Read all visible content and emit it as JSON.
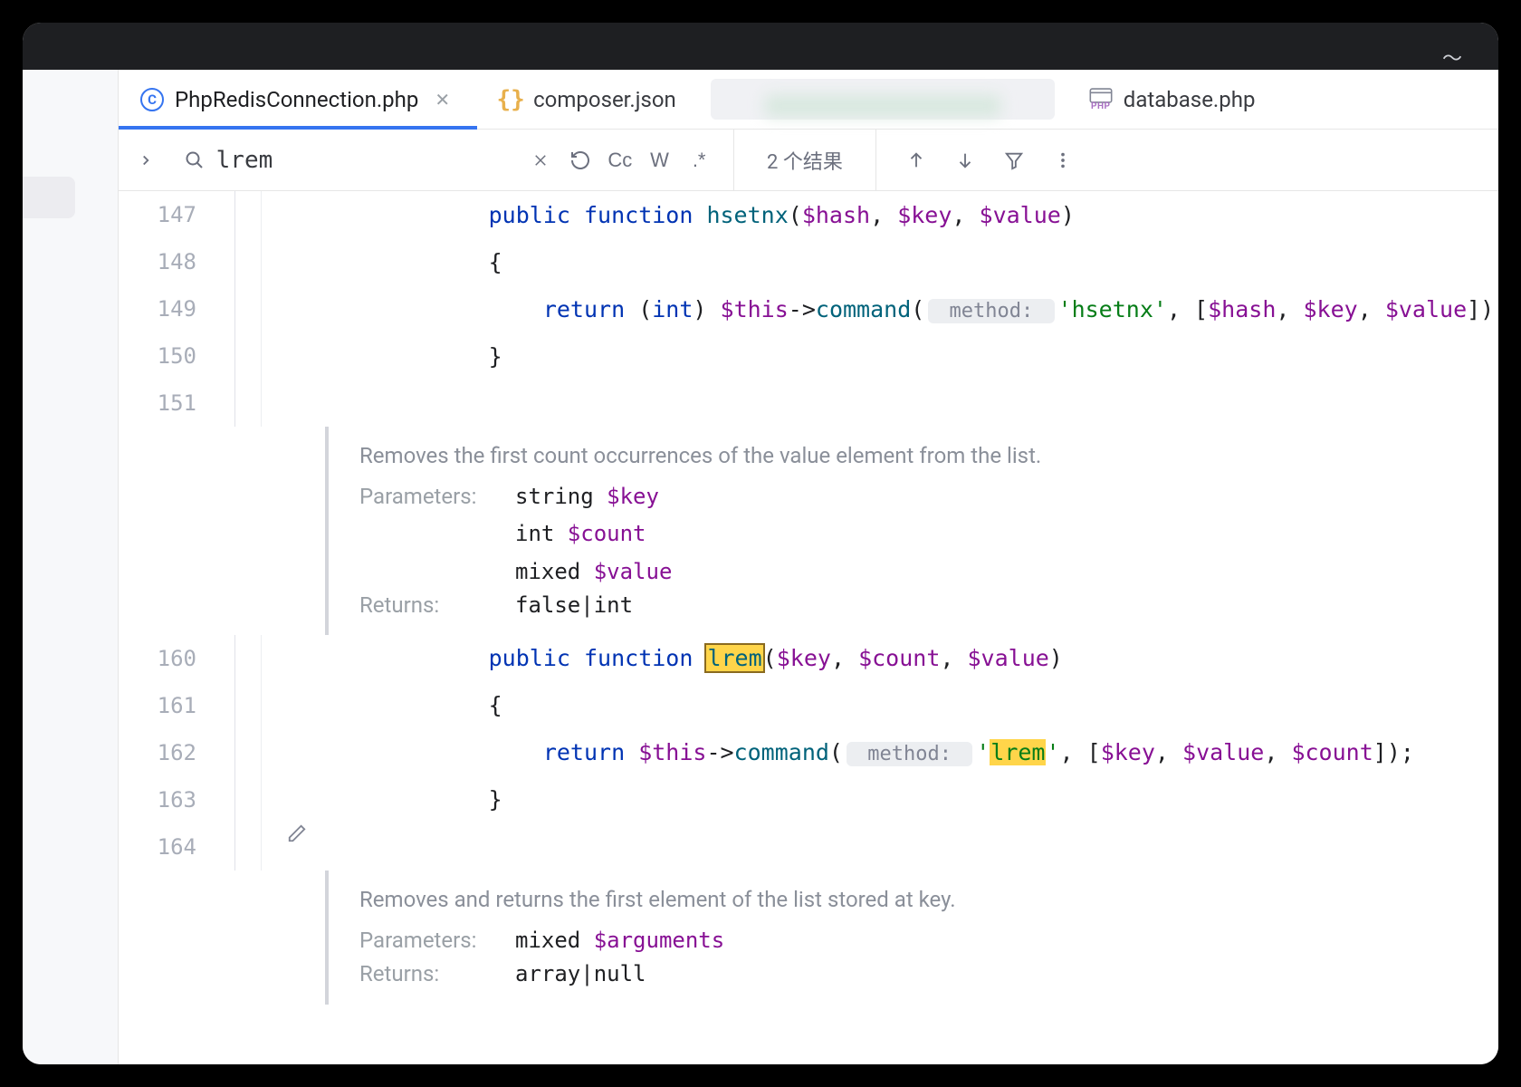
{
  "tabs": [
    {
      "label": "PhpRedisConnection.php",
      "icon": "c-circle",
      "active": true,
      "closeable": true
    },
    {
      "label": "composer.json",
      "icon": "braces",
      "active": false,
      "closeable": false
    },
    {
      "label": "",
      "icon": "blurred",
      "active": false
    },
    {
      "label": "database.php",
      "icon": "php",
      "active": false,
      "closeable": false
    }
  ],
  "search": {
    "query": "lrem",
    "results_text": "2 个结果",
    "options": {
      "cc": "Cc",
      "w": "W",
      "regex": ".*"
    }
  },
  "code": {
    "lines": [
      {
        "n": 147,
        "indent": 3,
        "tokens": [
          {
            "t": "public ",
            "c": "kw"
          },
          {
            "t": "function ",
            "c": "kw"
          },
          {
            "t": "hsetnx",
            "c": "fn"
          },
          {
            "t": "(",
            "c": "punc"
          },
          {
            "t": "$hash",
            "c": "var"
          },
          {
            "t": ", ",
            "c": "punc"
          },
          {
            "t": "$key",
            "c": "var"
          },
          {
            "t": ", ",
            "c": "punc"
          },
          {
            "t": "$value",
            "c": "var"
          },
          {
            "t": ")",
            "c": "punc"
          }
        ]
      },
      {
        "n": 148,
        "indent": 3,
        "tokens": [
          {
            "t": "{",
            "c": "punc"
          }
        ]
      },
      {
        "n": 149,
        "indent": 4,
        "tokens": [
          {
            "t": "return ",
            "c": "kw"
          },
          {
            "t": "(",
            "c": "punc"
          },
          {
            "t": "int",
            "c": "kw"
          },
          {
            "t": ") ",
            "c": "punc"
          },
          {
            "t": "$this",
            "c": "var"
          },
          {
            "t": "->",
            "c": "punc"
          },
          {
            "t": "command",
            "c": "fn"
          },
          {
            "t": "(",
            "c": "punc"
          },
          {
            "t": " method: ",
            "c": "hint"
          },
          {
            "t": "'hsetnx'",
            "c": "str"
          },
          {
            "t": ", [",
            "c": "punc"
          },
          {
            "t": "$hash",
            "c": "var"
          },
          {
            "t": ", ",
            "c": "punc"
          },
          {
            "t": "$key",
            "c": "var"
          },
          {
            "t": ", ",
            "c": "punc"
          },
          {
            "t": "$value",
            "c": "var"
          },
          {
            "t": "]);",
            "c": "punc"
          }
        ]
      },
      {
        "n": 150,
        "indent": 3,
        "tokens": [
          {
            "t": "}",
            "c": "punc"
          }
        ]
      },
      {
        "n": 151,
        "indent": 0,
        "tokens": []
      },
      {
        "type": "doc",
        "desc": "Removes the first count occurrences of the value element from the list.",
        "params": [
          {
            "type": "string",
            "name": "$key"
          },
          {
            "type": "int",
            "name": "$count"
          },
          {
            "type": "mixed",
            "name": "$value"
          }
        ],
        "returns": "false|int"
      },
      {
        "n": 160,
        "indent": 3,
        "tokens": [
          {
            "t": "public ",
            "c": "kw"
          },
          {
            "t": "function ",
            "c": "kw"
          },
          {
            "t": "lrem",
            "c": "fn",
            "hl": "boxed"
          },
          {
            "t": "(",
            "c": "punc"
          },
          {
            "t": "$key",
            "c": "var"
          },
          {
            "t": ", ",
            "c": "punc"
          },
          {
            "t": "$count",
            "c": "var"
          },
          {
            "t": ", ",
            "c": "punc"
          },
          {
            "t": "$value",
            "c": "var"
          },
          {
            "t": ")",
            "c": "punc"
          }
        ]
      },
      {
        "n": 161,
        "indent": 3,
        "tokens": [
          {
            "t": "{",
            "c": "punc"
          }
        ]
      },
      {
        "n": 162,
        "indent": 4,
        "tokens": [
          {
            "t": "return ",
            "c": "kw"
          },
          {
            "t": "$this",
            "c": "var"
          },
          {
            "t": "->",
            "c": "punc"
          },
          {
            "t": "command",
            "c": "fn"
          },
          {
            "t": "(",
            "c": "punc"
          },
          {
            "t": " method: ",
            "c": "hint"
          },
          {
            "t": "'",
            "c": "str"
          },
          {
            "t": "lrem",
            "c": "str",
            "hl": "plain"
          },
          {
            "t": "'",
            "c": "str"
          },
          {
            "t": ", [",
            "c": "punc"
          },
          {
            "t": "$key",
            "c": "var"
          },
          {
            "t": ", ",
            "c": "punc"
          },
          {
            "t": "$value",
            "c": "var"
          },
          {
            "t": ", ",
            "c": "punc"
          },
          {
            "t": "$count",
            "c": "var"
          },
          {
            "t": "]);",
            "c": "punc"
          }
        ]
      },
      {
        "n": 163,
        "indent": 3,
        "tokens": [
          {
            "t": "}",
            "c": "punc"
          }
        ]
      },
      {
        "n": 164,
        "indent": 0,
        "tokens": [],
        "pencil": true
      },
      {
        "type": "doc",
        "desc": "Removes and returns the first element of the list stored at key.",
        "params": [
          {
            "type": "mixed",
            "name": "$arguments"
          }
        ],
        "returns": "array|null"
      }
    ]
  },
  "labels": {
    "parameters": "Parameters:",
    "returns": "Returns:"
  }
}
